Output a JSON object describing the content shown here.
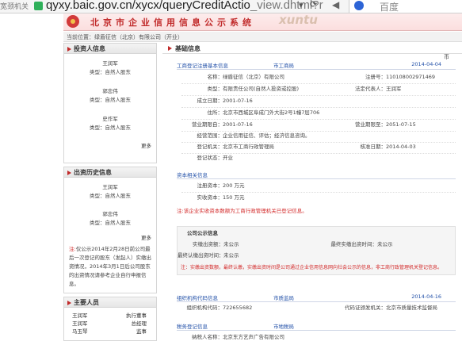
{
  "browser": {
    "tab_text": "宽颈机关",
    "url_main": "qyxy.baic.gov.cn",
    "url_path": "/xycx/queryCreditActio",
    "url_tail": "_view.dhtml?r",
    "search_text": "百度",
    "dropdown_symbol": "▾",
    "reload_symbol": "⟳",
    "back_symbol": "◀"
  },
  "site": {
    "title": "北京市企业信用信息公示系统",
    "watermark": "xuntu"
  },
  "breadcrumb": "当前位置：绿盾征信（北京）有限公司（开业）",
  "left": {
    "investor_title": "投资人信息",
    "investors": [
      {
        "name": "王润军",
        "type": "类型：自然人股东"
      },
      {
        "name": "郭忠伟",
        "type": "类型：自然人股东"
      },
      {
        "name": "史作军",
        "type": "类型：自然人股东"
      }
    ],
    "more_label": "更多",
    "history_title": "出资历史信息",
    "history": [
      {
        "name": "王润军",
        "type": "类型：自然人股东"
      },
      {
        "name": "郭忠伟",
        "type": "类型：自然人股东"
      }
    ],
    "history_note_prefix": "注:",
    "history_note": "仅公示2014年2月28日前公司最后一次登记的股东（发起人）实缴出资情况，2014年3月1日后公司股东的出资情况请参考企业自行申报信息。",
    "staff_title": "主要人员",
    "staff": [
      {
        "name": "王润军",
        "role": "执行董事"
      },
      {
        "name": "王润军",
        "role": "总经理"
      },
      {
        "name": "马玉琴",
        "role": "监事"
      }
    ]
  },
  "right": {
    "header_title": "基础信息",
    "currency_note": "币",
    "reg_section": {
      "title": "工商登记注册基本信息",
      "org": "市工商局",
      "date": "2014-04-04"
    },
    "reg_fields": {
      "name_label": "名称：",
      "name": "绿盾征信（北京）有限公司",
      "regno_label": "注册号：",
      "regno": "110108002971469",
      "type_label": "类型：",
      "type": "有限责任公司(自然人投资或控股)",
      "legal_label": "法定代表人：",
      "legal": "王润军",
      "estab_label": "成立日期：",
      "estab": "2001-07-16",
      "addr_label": "住所：",
      "addr": "北京市西城区阜成门外大街2号1幢7层706",
      "from_label": "营业期限自：",
      "from": "2001-07-16",
      "to_label": "营业期限至：",
      "to": "2051-07-15",
      "scope_label": "经营范围：",
      "scope": "企业信用征信、评估；经济信息咨询。",
      "authority_label": "登记机关：",
      "authority": "北京市工商行政管理局",
      "approve_label": "核准日期：",
      "approve": "2014-04-03",
      "status_label": "登记状态：",
      "status": "开业"
    },
    "capital_section": {
      "title": "资本相关信息"
    },
    "capital_fields": {
      "reg_cap_label": "注册资本：",
      "reg_cap": "200 万元",
      "paid_cap_label": "实收资本：",
      "paid_cap": "150 万元"
    },
    "capital_note": "注:该企业实收资本数额为工商行政管理机关已登记信息。",
    "public_box": {
      "title": "公司公示信息",
      "paid_label": "实缴出资额：",
      "paid": "未公示",
      "latest_time_label": "最终实缴出资时间：",
      "latest_time": "未公示",
      "latest_amt_label": "最终认缴出资时间：",
      "latest_amt": "未公示",
      "note": "注：实缴出资数额，最终认缴，实缴出资时间是公司通过企业信用信息网向社会公示的信息，非工商行政管理机关登记信息。"
    },
    "org_section": {
      "title": "组织机构代码信息",
      "org": "市质监局",
      "date": "2014-04-16"
    },
    "org_fields": {
      "code_label": "组织机构代码：",
      "code": "722655682",
      "issuer_label": "代码证颁发机关：",
      "issuer": "北京市质量技术监督局"
    },
    "tax_section": {
      "title": "税务登记信息",
      "org": "市地税局"
    },
    "tax_fields": {
      "taxpayer_label": "纳税人名称：",
      "taxpayer": "北京东方艺声广告有限公司"
    }
  }
}
